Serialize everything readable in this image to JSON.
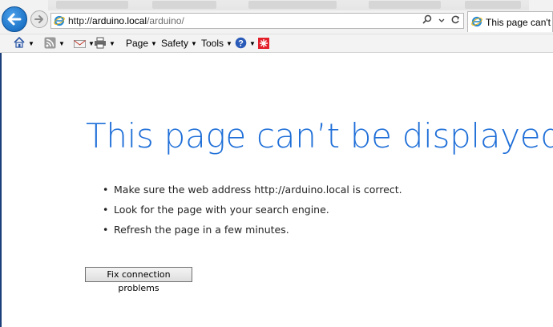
{
  "address_bar": {
    "url_scheme": "http://",
    "url_host": "arduino.local",
    "url_path": "/arduino/"
  },
  "tab": {
    "title": "This page can't be"
  },
  "command_bar": {
    "page_label": "Page",
    "safety_label": "Safety",
    "tools_label": "Tools"
  },
  "error": {
    "title": "This page can’t be displayed",
    "bullets": [
      "Make sure the web address http://arduino.local is correct.",
      "Look for the page with your search engine.",
      "Refresh the page in a few minutes."
    ],
    "fix_button_label": "Fix connection problems"
  },
  "icons": {
    "back": "arrow-left-icon",
    "forward": "arrow-right-icon",
    "site": "ie-logo-icon",
    "search": "search-icon",
    "refresh": "refresh-icon",
    "home": "home-icon",
    "feeds": "rss-feed-icon",
    "mail": "mail-icon",
    "print": "printer-icon",
    "help": "help-icon",
    "addon": "addon-icon"
  },
  "colors": {
    "title_blue": "#1f6fd8",
    "back_button_blue": "#0b61b8",
    "addon_red": "#e3202a"
  }
}
